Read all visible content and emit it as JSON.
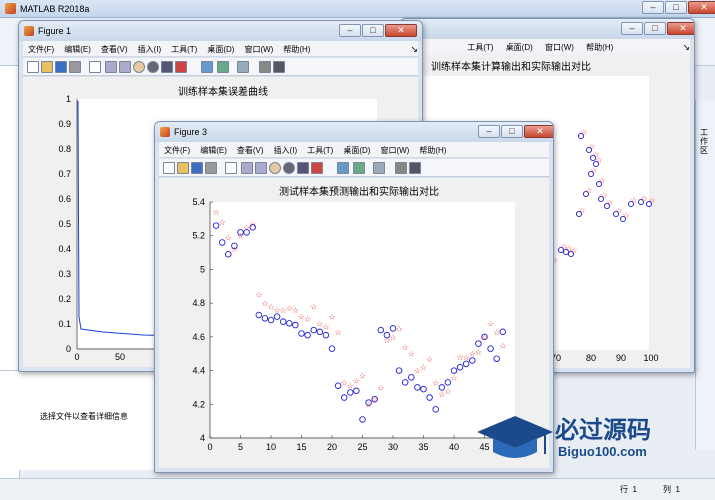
{
  "app": {
    "title": "MATLAB R2018a",
    "controls": [
      "–",
      "□",
      "✕"
    ]
  },
  "detail_text": "选择文件以查看详细信息",
  "right_panel_label": "工作区",
  "status": {
    "row_label": "行",
    "row": "1",
    "col_label": "列",
    "col": "1"
  },
  "figure_menu": [
    "文件(F)",
    "编辑(E)",
    "查看(V)",
    "插入(I)",
    "工具(T)",
    "桌面(D)",
    "窗口(W)",
    "帮助(H)"
  ],
  "icons": [
    "new-file-icon",
    "open-folder-icon",
    "save-icon",
    "print-icon",
    "pointer-icon",
    "zoom-in-icon",
    "zoom-out-icon",
    "pan-icon",
    "rotate-icon",
    "data-cursor-icon",
    "brush-icon",
    "link-icon",
    "colorbar-icon",
    "legend-icon",
    "hide-tools-icon",
    "dock-icon"
  ],
  "figure1": {
    "title": "Figure 1",
    "axes_title": "训练样本集误差曲线",
    "yticks": [
      "1",
      "0.9",
      "0.8",
      "0.7",
      "0.6",
      "0.5",
      "0.4",
      "0.3",
      "0.2",
      "0.1",
      "0"
    ],
    "xticks": [
      "0",
      "50"
    ]
  },
  "figure2": {
    "axes_title": "训练样本集计算输出和实际输出对比",
    "xticks": [
      "70",
      "80",
      "90",
      "100"
    ]
  },
  "figure3": {
    "title": "Figure 3"
  },
  "watermark": {
    "text": "必过源码",
    "url": "Biguo100.com"
  },
  "colors": {
    "circle": "#1f1fd6",
    "star": "#e81f1f",
    "err_line": "#1f3fd6"
  },
  "chart_data": [
    {
      "type": "scatter",
      "title": "测试样本集预测输出和实际输出对比",
      "xlim": [
        0,
        50
      ],
      "ylim": [
        4,
        5.4
      ],
      "xticks": [
        0,
        5,
        10,
        15,
        20,
        25,
        30,
        35,
        40,
        45
      ],
      "yticks": [
        4,
        4.2,
        4.4,
        4.6,
        4.8,
        5,
        5.2,
        5.4
      ],
      "series": [
        {
          "marker": "circle",
          "color": "#1f1fd6",
          "x": [
            1,
            2,
            3,
            4,
            5,
            6,
            7,
            8,
            9,
            10,
            11,
            12,
            13,
            14,
            15,
            16,
            17,
            18,
            19,
            20,
            21,
            22,
            23,
            24,
            25,
            26,
            27,
            28,
            29,
            30,
            31,
            32,
            33,
            34,
            35,
            36,
            37,
            38,
            39,
            40,
            41,
            42,
            43,
            44,
            45,
            46,
            47,
            48
          ],
          "y": [
            5.26,
            5.16,
            5.09,
            5.14,
            5.22,
            5.22,
            5.25,
            4.73,
            4.71,
            4.7,
            4.72,
            4.69,
            4.68,
            4.67,
            4.62,
            4.61,
            4.64,
            4.63,
            4.61,
            4.53,
            4.31,
            4.24,
            4.27,
            4.28,
            4.11,
            4.21,
            4.23,
            4.64,
            4.61,
            4.65,
            4.4,
            4.33,
            4.36,
            4.3,
            4.29,
            4.24,
            4.17,
            4.3,
            4.33,
            4.4,
            4.42,
            4.44,
            4.46,
            4.56,
            4.6,
            4.53,
            4.47,
            4.63
          ]
        },
        {
          "marker": "star",
          "color": "#e81f1f",
          "x": [
            1,
            2,
            3,
            4,
            5,
            6,
            7,
            8,
            9,
            10,
            11,
            12,
            13,
            14,
            15,
            16,
            17,
            18,
            19,
            20,
            21,
            22,
            23,
            24,
            25,
            26,
            27,
            28,
            29,
            30,
            31,
            32,
            33,
            34,
            35,
            36,
            37,
            38,
            39,
            40,
            41,
            42,
            43,
            44,
            45,
            46,
            47,
            48
          ],
          "y": [
            5.34,
            5.28,
            5.19,
            5.12,
            5.2,
            5.25,
            5.27,
            4.85,
            4.8,
            4.78,
            4.76,
            4.76,
            4.77,
            4.76,
            4.72,
            4.71,
            4.78,
            4.68,
            4.66,
            4.72,
            4.63,
            4.33,
            4.31,
            4.34,
            4.37,
            4.2,
            4.23,
            4.3,
            4.58,
            4.6,
            4.65,
            4.54,
            4.5,
            4.4,
            4.42,
            4.47,
            4.33,
            4.26,
            4.28,
            4.36,
            4.48,
            4.48,
            4.5,
            4.51,
            4.6,
            4.68,
            4.63,
            4.55
          ]
        }
      ]
    }
  ]
}
